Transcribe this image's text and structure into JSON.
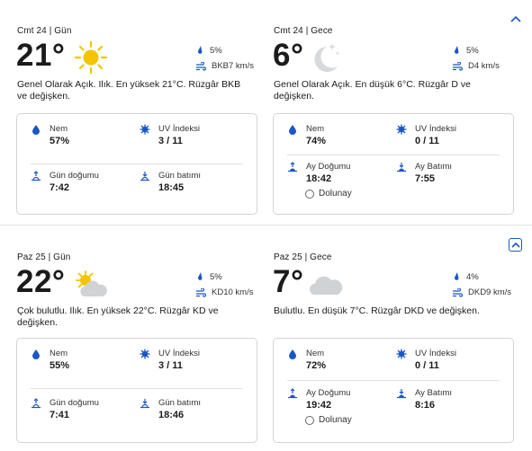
{
  "days": [
    {
      "collapse_icon": "chevron-up-icon",
      "panels": [
        {
          "label": "Cmt 24 | Gün",
          "temp": "21°",
          "icon": "sun-icon",
          "rain": "5%",
          "wind": "BKB7 km/s",
          "desc": "Genel Olarak Açık. Ilık. En yüksek 21°C. Rüzgâr BKB ve değişken.",
          "top_left": {
            "label": "Nem",
            "value": "57%"
          },
          "top_right": {
            "label": "UV İndeksi",
            "value": "3 / 11"
          },
          "bottom_left": {
            "label": "Gün doğumu",
            "value": "7:42"
          },
          "bottom_right": {
            "label": "Gün batımı",
            "value": "18:45"
          }
        },
        {
          "label": "Cmt 24 | Gece",
          "temp": "6°",
          "icon": "moon-stars-icon",
          "rain": "5%",
          "wind": "D4 km/s",
          "desc": "Genel Olarak Açık. En düşük 6°C. Rüzgâr D ve değişken.",
          "top_left": {
            "label": "Nem",
            "value": "74%"
          },
          "top_right": {
            "label": "UV İndeksi",
            "value": "0 / 11"
          },
          "bottom_left": {
            "label": "Ay Doğumu",
            "value": "18:42"
          },
          "bottom_right": {
            "label": "Ay Batımı",
            "value": "7:55"
          },
          "moon_phase": "Dolunay"
        }
      ]
    },
    {
      "collapse_icon": "chevron-up-icon",
      "panels": [
        {
          "label": "Paz 25 | Gün",
          "temp": "22°",
          "icon": "partly-cloudy-icon",
          "rain": "5%",
          "wind": "KD10 km/s",
          "desc": "Çok bulutlu. Ilık. En yüksek 22°C. Rüzgâr KD ve değişken.",
          "top_left": {
            "label": "Nem",
            "value": "55%"
          },
          "top_right": {
            "label": "UV İndeksi",
            "value": "3 / 11"
          },
          "bottom_left": {
            "label": "Gün doğumu",
            "value": "7:41"
          },
          "bottom_right": {
            "label": "Gün batımı",
            "value": "18:46"
          }
        },
        {
          "label": "Paz 25 | Gece",
          "temp": "7°",
          "icon": "cloud-icon",
          "rain": "4%",
          "wind": "DKD9 km/s",
          "desc": "Bulutlu. En düşük 7°C. Rüzgâr DKD ve değişken.",
          "top_left": {
            "label": "Nem",
            "value": "72%"
          },
          "top_right": {
            "label": "UV İndeksi",
            "value": "0 / 11"
          },
          "bottom_left": {
            "label": "Ay Doğumu",
            "value": "19:42"
          },
          "bottom_right": {
            "label": "Ay Batımı",
            "value": "8:16"
          },
          "moon_phase": "Dolunay"
        }
      ]
    }
  ],
  "colors": {
    "accent": "#1a56c8",
    "sun": "#f5c400",
    "cloud": "#cfd3d6",
    "text": "#1b1b1b"
  }
}
